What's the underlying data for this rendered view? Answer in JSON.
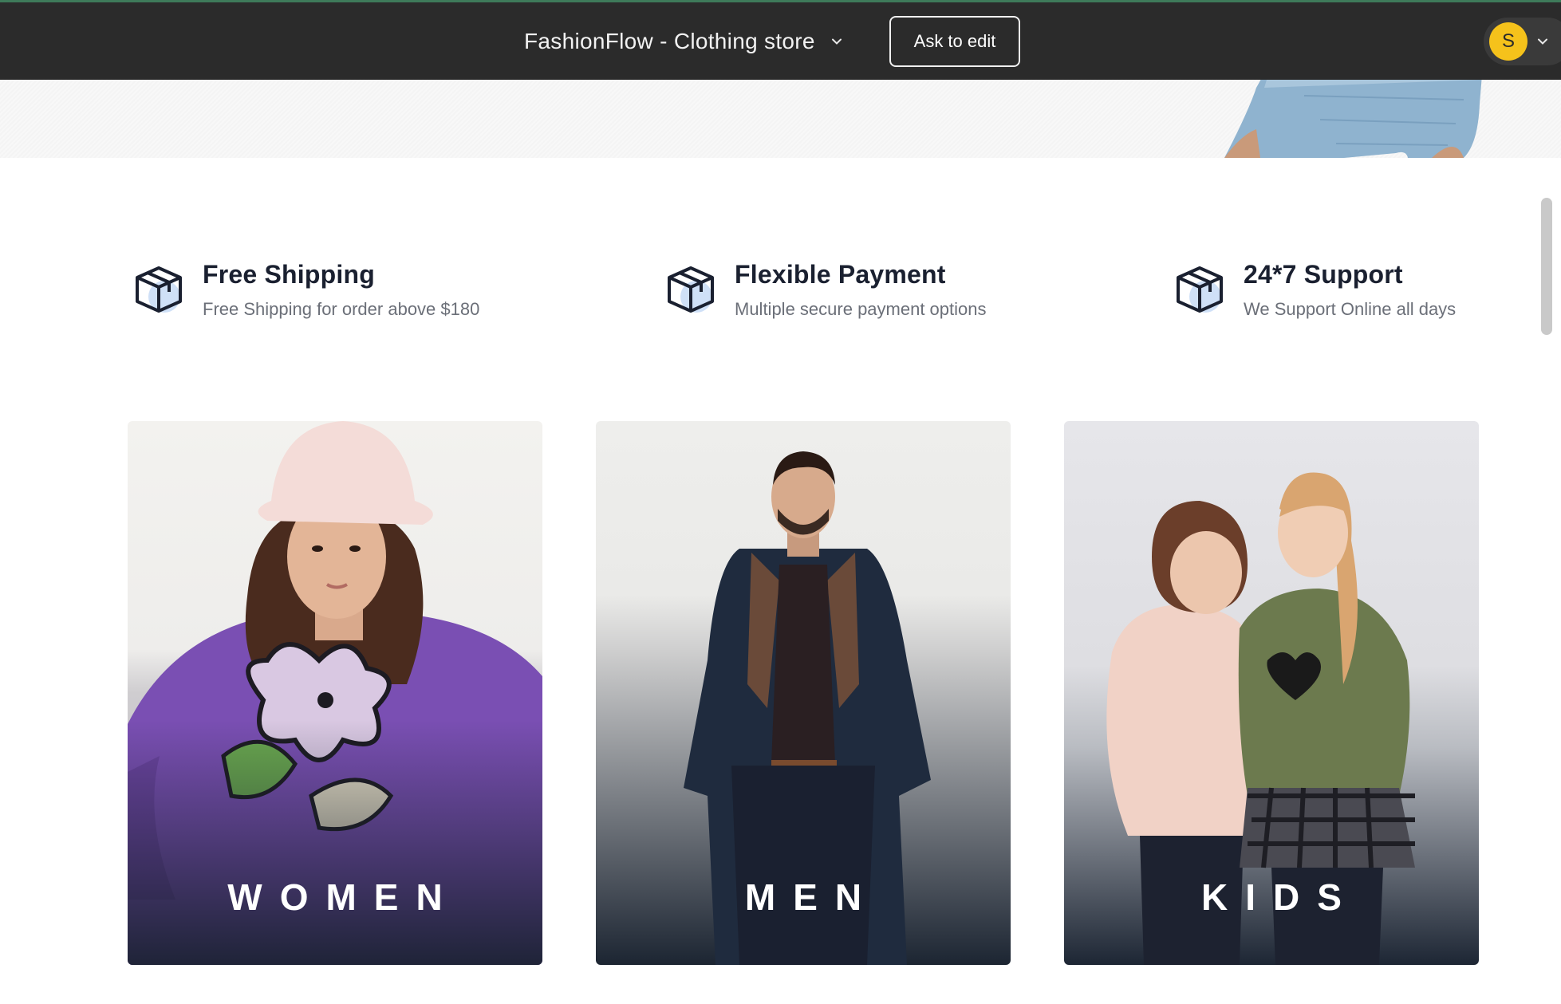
{
  "topbar": {
    "title": "FashionFlow - Clothing store",
    "ask_button": "Ask to edit",
    "avatar_initial": "S"
  },
  "features": [
    {
      "title": "Free Shipping",
      "subtitle": "Free Shipping for order above $180",
      "icon": "box-icon"
    },
    {
      "title": "Flexible Payment",
      "subtitle": "Multiple secure payment options",
      "icon": "box-icon"
    },
    {
      "title": "24*7 Support",
      "subtitle": "We Support Online all days",
      "icon": "box-icon"
    }
  ],
  "categories": [
    {
      "label": "WOMEN"
    },
    {
      "label": "MEN"
    },
    {
      "label": "KIDS"
    }
  ],
  "colors": {
    "topbar": "#2b2b2b",
    "avatar": "#f5c21b",
    "icon_accent": "#cfe0f7",
    "heading": "#1a2030",
    "muted": "#6b6f78"
  }
}
